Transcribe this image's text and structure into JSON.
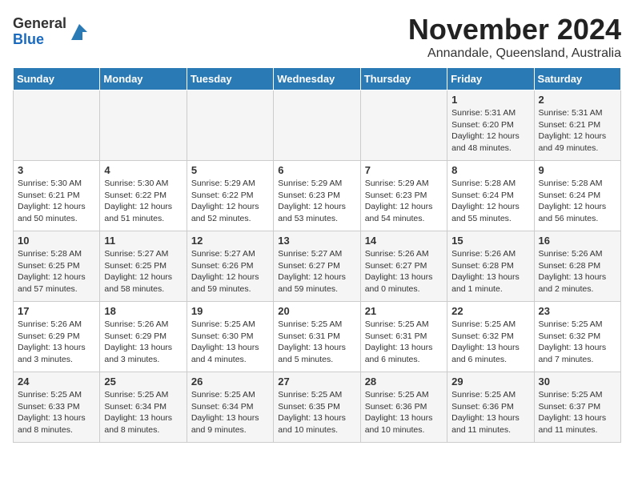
{
  "logo": {
    "general": "General",
    "blue": "Blue"
  },
  "title": "November 2024",
  "subtitle": "Annandale, Queensland, Australia",
  "weekdays": [
    "Sunday",
    "Monday",
    "Tuesday",
    "Wednesday",
    "Thursday",
    "Friday",
    "Saturday"
  ],
  "weeks": [
    [
      {
        "day": "",
        "info": ""
      },
      {
        "day": "",
        "info": ""
      },
      {
        "day": "",
        "info": ""
      },
      {
        "day": "",
        "info": ""
      },
      {
        "day": "",
        "info": ""
      },
      {
        "day": "1",
        "info": "Sunrise: 5:31 AM\nSunset: 6:20 PM\nDaylight: 12 hours\nand 48 minutes."
      },
      {
        "day": "2",
        "info": "Sunrise: 5:31 AM\nSunset: 6:21 PM\nDaylight: 12 hours\nand 49 minutes."
      }
    ],
    [
      {
        "day": "3",
        "info": "Sunrise: 5:30 AM\nSunset: 6:21 PM\nDaylight: 12 hours\nand 50 minutes."
      },
      {
        "day": "4",
        "info": "Sunrise: 5:30 AM\nSunset: 6:22 PM\nDaylight: 12 hours\nand 51 minutes."
      },
      {
        "day": "5",
        "info": "Sunrise: 5:29 AM\nSunset: 6:22 PM\nDaylight: 12 hours\nand 52 minutes."
      },
      {
        "day": "6",
        "info": "Sunrise: 5:29 AM\nSunset: 6:23 PM\nDaylight: 12 hours\nand 53 minutes."
      },
      {
        "day": "7",
        "info": "Sunrise: 5:29 AM\nSunset: 6:23 PM\nDaylight: 12 hours\nand 54 minutes."
      },
      {
        "day": "8",
        "info": "Sunrise: 5:28 AM\nSunset: 6:24 PM\nDaylight: 12 hours\nand 55 minutes."
      },
      {
        "day": "9",
        "info": "Sunrise: 5:28 AM\nSunset: 6:24 PM\nDaylight: 12 hours\nand 56 minutes."
      }
    ],
    [
      {
        "day": "10",
        "info": "Sunrise: 5:28 AM\nSunset: 6:25 PM\nDaylight: 12 hours\nand 57 minutes."
      },
      {
        "day": "11",
        "info": "Sunrise: 5:27 AM\nSunset: 6:25 PM\nDaylight: 12 hours\nand 58 minutes."
      },
      {
        "day": "12",
        "info": "Sunrise: 5:27 AM\nSunset: 6:26 PM\nDaylight: 12 hours\nand 59 minutes."
      },
      {
        "day": "13",
        "info": "Sunrise: 5:27 AM\nSunset: 6:27 PM\nDaylight: 12 hours\nand 59 minutes."
      },
      {
        "day": "14",
        "info": "Sunrise: 5:26 AM\nSunset: 6:27 PM\nDaylight: 13 hours\nand 0 minutes."
      },
      {
        "day": "15",
        "info": "Sunrise: 5:26 AM\nSunset: 6:28 PM\nDaylight: 13 hours\nand 1 minute."
      },
      {
        "day": "16",
        "info": "Sunrise: 5:26 AM\nSunset: 6:28 PM\nDaylight: 13 hours\nand 2 minutes."
      }
    ],
    [
      {
        "day": "17",
        "info": "Sunrise: 5:26 AM\nSunset: 6:29 PM\nDaylight: 13 hours\nand 3 minutes."
      },
      {
        "day": "18",
        "info": "Sunrise: 5:26 AM\nSunset: 6:29 PM\nDaylight: 13 hours\nand 3 minutes."
      },
      {
        "day": "19",
        "info": "Sunrise: 5:25 AM\nSunset: 6:30 PM\nDaylight: 13 hours\nand 4 minutes."
      },
      {
        "day": "20",
        "info": "Sunrise: 5:25 AM\nSunset: 6:31 PM\nDaylight: 13 hours\nand 5 minutes."
      },
      {
        "day": "21",
        "info": "Sunrise: 5:25 AM\nSunset: 6:31 PM\nDaylight: 13 hours\nand 6 minutes."
      },
      {
        "day": "22",
        "info": "Sunrise: 5:25 AM\nSunset: 6:32 PM\nDaylight: 13 hours\nand 6 minutes."
      },
      {
        "day": "23",
        "info": "Sunrise: 5:25 AM\nSunset: 6:32 PM\nDaylight: 13 hours\nand 7 minutes."
      }
    ],
    [
      {
        "day": "24",
        "info": "Sunrise: 5:25 AM\nSunset: 6:33 PM\nDaylight: 13 hours\nand 8 minutes."
      },
      {
        "day": "25",
        "info": "Sunrise: 5:25 AM\nSunset: 6:34 PM\nDaylight: 13 hours\nand 8 minutes."
      },
      {
        "day": "26",
        "info": "Sunrise: 5:25 AM\nSunset: 6:34 PM\nDaylight: 13 hours\nand 9 minutes."
      },
      {
        "day": "27",
        "info": "Sunrise: 5:25 AM\nSunset: 6:35 PM\nDaylight: 13 hours\nand 10 minutes."
      },
      {
        "day": "28",
        "info": "Sunrise: 5:25 AM\nSunset: 6:36 PM\nDaylight: 13 hours\nand 10 minutes."
      },
      {
        "day": "29",
        "info": "Sunrise: 5:25 AM\nSunset: 6:36 PM\nDaylight: 13 hours\nand 11 minutes."
      },
      {
        "day": "30",
        "info": "Sunrise: 5:25 AM\nSunset: 6:37 PM\nDaylight: 13 hours\nand 11 minutes."
      }
    ]
  ]
}
